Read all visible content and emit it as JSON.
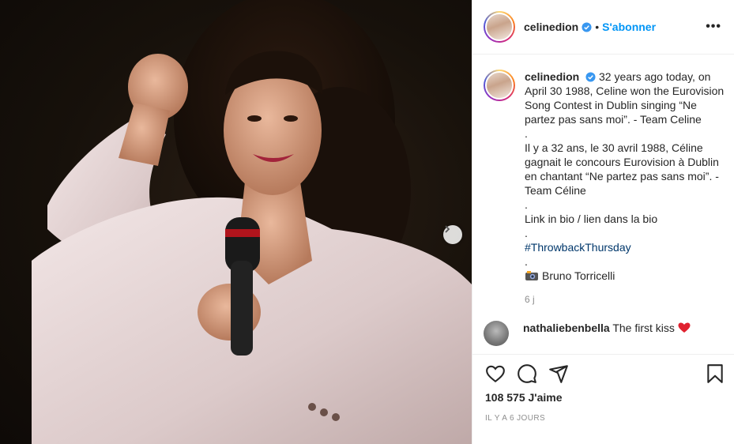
{
  "post": {
    "username": "celinedion",
    "follow_label": "S'abonner",
    "separator": "•",
    "more_label": "•••"
  },
  "caption": {
    "username": "celinedion",
    "paragraphs": [
      "32 years ago today, on April 30 1988, Celine won the Eurovision Song Contest in Dublin singing “Ne partez pas sans moi”. - Team Celine",
      ".",
      "Il y a 32 ans, le 30 avril 1988, Céline gagnait le concours Eurovision à Dublin en chantant “Ne partez pas sans moi”. - Team Céline",
      ".",
      "Link in bio / lien dans la bio",
      ".",
      "#ThrowbackThursday",
      ".",
      "Bruno Torricelli"
    ],
    "time": "6 j"
  },
  "comment": {
    "username": "nathaliebenbella",
    "text": "The first kiss"
  },
  "stats": {
    "likes": "108 575 J'aime",
    "posted_ago": "Il y a 6 jours"
  },
  "icons": {
    "verified": "verified-badge-icon",
    "like": "heart-icon",
    "comment": "comment-icon",
    "share": "share-icon",
    "save": "bookmark-icon",
    "next": "chevron-right-icon",
    "camera": "camera-emoji-icon"
  },
  "colors": {
    "accent": "#0095f6",
    "hashtag": "#00376b",
    "muted": "#8e8e8e",
    "heart": "#ed4956"
  }
}
